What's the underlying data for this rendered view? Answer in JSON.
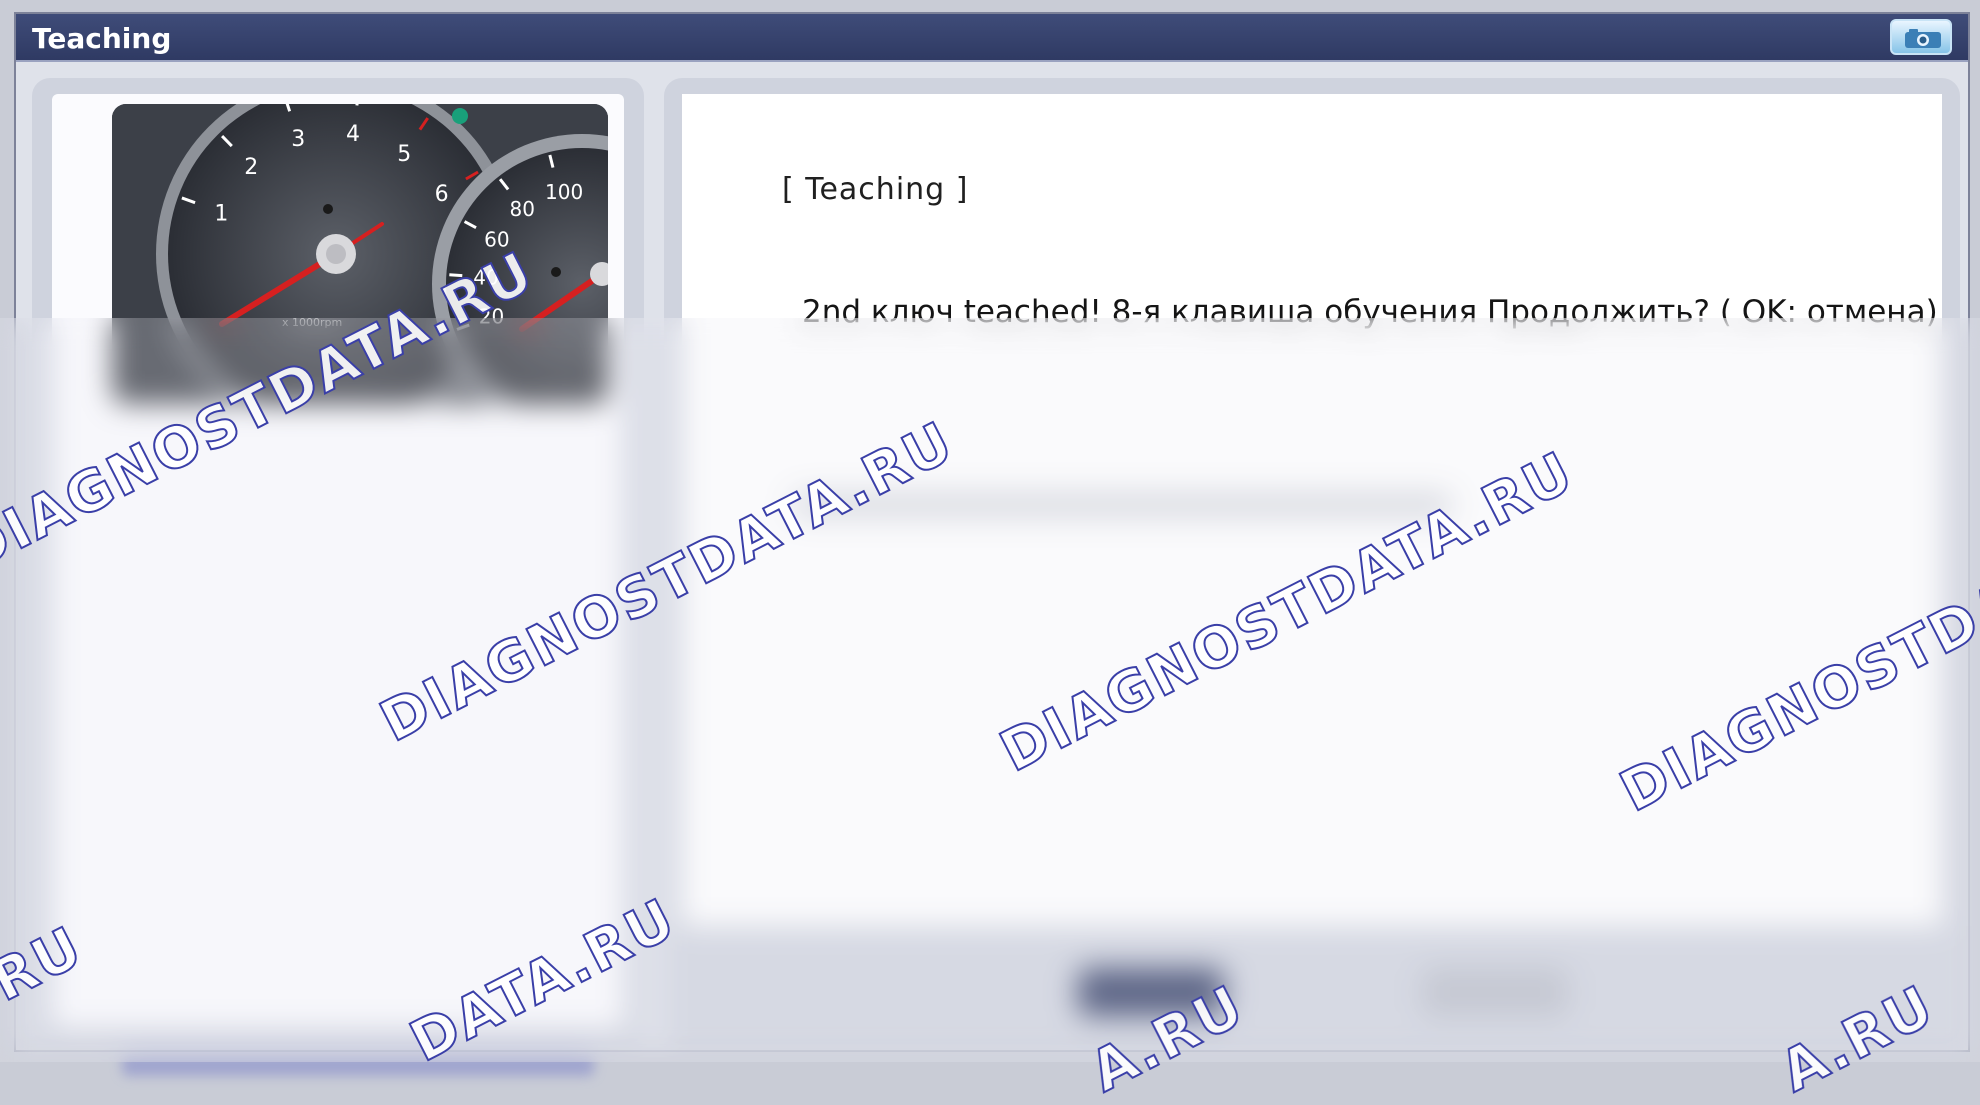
{
  "window": {
    "title": "Teaching",
    "camera_icon": "camera-icon"
  },
  "left": {
    "image": "instrument-cluster-gauge",
    "tachometer_ticks": [
      "1",
      "2",
      "3",
      "4",
      "5",
      "6"
    ],
    "tachometer_unit": "x 1000rpm",
    "speedometer_ticks": [
      "20",
      "40",
      "60",
      "80",
      "100"
    ]
  },
  "main": {
    "section_title": "[ Teaching ]",
    "message": "2nd ключ teached! 8-я клавиша обучения Продолжить? ( OK: отмена)"
  },
  "watermark": {
    "text": "DIAGNOSTDATA.RU",
    "short_text": "DATA.RU",
    "tail_text": "A.RU",
    "tail2_text": ".RU",
    "color": "#3a3fa8"
  },
  "colors": {
    "titlebar": "#2f3a63",
    "panel": "#cfd3de",
    "needle": "#d62020"
  }
}
